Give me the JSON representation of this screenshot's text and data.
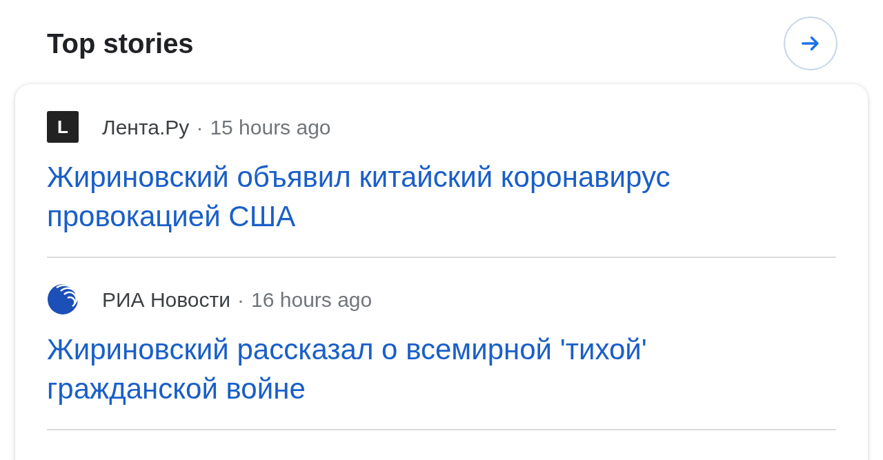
{
  "section": {
    "title": "Top stories"
  },
  "stories": [
    {
      "logo": {
        "kind": "letter",
        "text": "L"
      },
      "source": "Лента.Ру",
      "separator": "·",
      "time": "15 hours ago",
      "headline": "Жириновский объявил китайский коронавирус провокацией США"
    },
    {
      "logo": {
        "kind": "globe"
      },
      "source": "РИА Новости",
      "separator": "·",
      "time": "16 hours ago",
      "headline": "Жириновский рассказал о всемирной 'тихой' гражданской войне"
    }
  ]
}
